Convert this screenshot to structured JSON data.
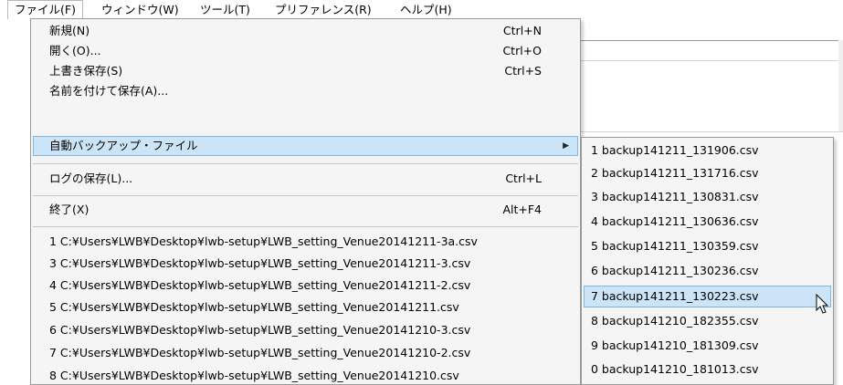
{
  "menubar": {
    "items": [
      "ファイル(F)",
      "ウィンドウ(W)",
      "ツール(T)",
      "プリファレンス(R)",
      "ヘルプ(H)"
    ]
  },
  "file_menu": {
    "items": [
      {
        "label": "新規(N)",
        "shortcut": "Ctrl+N"
      },
      {
        "label": "開く(O)...",
        "shortcut": "Ctrl+O"
      },
      {
        "label": "上書き保存(S)",
        "shortcut": "Ctrl+S"
      },
      {
        "label": "名前を付けて保存(A)...",
        "shortcut": ""
      },
      {
        "label": "自動バックアップ・ファイル",
        "shortcut": ""
      },
      {
        "label": "ログの保存(L)...",
        "shortcut": "Ctrl+L"
      },
      {
        "label": "終了(X)",
        "shortcut": "Alt+F4"
      }
    ],
    "submenu_arrow": "▶",
    "recent_files": [
      "1 C:¥Users¥LWB¥Desktop¥lwb-setup¥LWB_setting_Venue20141211-3a.csv",
      "3 C:¥Users¥LWB¥Desktop¥lwb-setup¥LWB_setting_Venue20141211-3.csv",
      "4 C:¥Users¥LWB¥Desktop¥lwb-setup¥LWB_setting_Venue20141211-2.csv",
      "5 C:¥Users¥LWB¥Desktop¥lwb-setup¥LWB_setting_Venue20141211.csv",
      "6 C:¥Users¥LWB¥Desktop¥lwb-setup¥LWB_setting_Venue20141210-3.csv",
      "7 C:¥Users¥LWB¥Desktop¥lwb-setup¥LWB_setting_Venue20141210-2.csv",
      "8 C:¥Users¥LWB¥Desktop¥lwb-setup¥LWB_setting_Venue20141210.csv"
    ]
  },
  "backup_submenu": {
    "items": [
      "1 backup141211_131906.csv",
      "2 backup141211_131716.csv",
      "3 backup141211_130831.csv",
      "4 backup141211_130636.csv",
      "5 backup141211_130359.csv",
      "6 backup141211_130236.csv",
      "7 backup141211_130223.csv",
      "8 backup141210_182355.csv",
      "9 backup141210_181309.csv",
      "0 backup141210_181013.csv"
    ]
  },
  "colors": {
    "highlight_bg": "#cce4f7",
    "highlight_border": "#7fb8e6",
    "menu_bg": "#f5f5f5"
  }
}
